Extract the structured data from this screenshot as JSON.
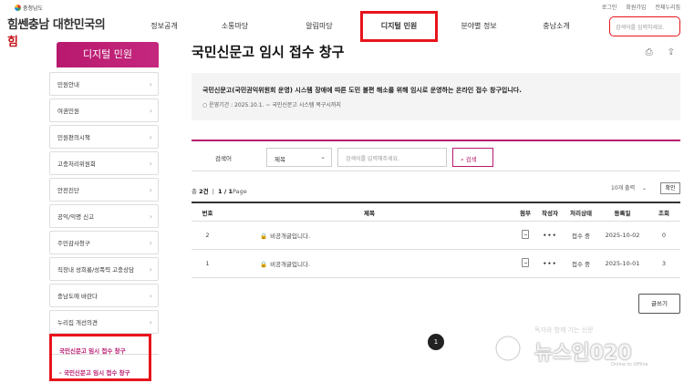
{
  "utility": [
    "로그인",
    "회원가입",
    "전체누리집"
  ],
  "logo": {
    "province": "충청남도",
    "slogan_a": "힘쎈충남",
    "slogan_b": "대한민국의",
    "slogan_c": "힘"
  },
  "gnb": [
    {
      "label": "정보공개"
    },
    {
      "label": "소통마당"
    },
    {
      "label": "알림마당"
    },
    {
      "label": "디지털 민원"
    },
    {
      "label": "분야별 정보"
    },
    {
      "label": "충남소개"
    }
  ],
  "top_search": {
    "placeholder": "검색어를 입력하세요."
  },
  "sidebar": {
    "title": "디지털 민원",
    "items": [
      {
        "label": "민원안내"
      },
      {
        "label": "여권민원"
      },
      {
        "label": "민원편의시책"
      },
      {
        "label": "고충처리위원회"
      },
      {
        "label": "안전진단"
      },
      {
        "label": "공익/익명 신고"
      },
      {
        "label": "주민감사청구"
      },
      {
        "label": "직장내 성희롱/성폭력 고충상담"
      },
      {
        "label": "충남도에 바란다"
      },
      {
        "label": "누리집 개선의견"
      }
    ],
    "active_group": "국민신문고 임시 접수 창구",
    "active_sub": "- 국민신문고 임시 접수 창구"
  },
  "page_title": "국민신문고 임시 접수 창구",
  "notice": {
    "text": "국민신문고(국민권익위원회 운영) 시스템 장애에 따른 도민 불편 해소를 위해 임시로 운영하는 온라인 접수 창구입니다.",
    "period": "○ 운영기간 : 2025.10.1. ~ 국민신문고 시스템 복구시까지"
  },
  "search": {
    "label": "검색어",
    "select_value": "제목",
    "placeholder": "검색어를 입력해주세요.",
    "button": "검색"
  },
  "count": {
    "prefix": "총",
    "total": "2건",
    "page": "1 / 1",
    "page_suffix": "Page"
  },
  "per_page": {
    "label": "10개 출력",
    "button": "확인"
  },
  "table": {
    "headers": [
      "번호",
      "제목",
      "첨부",
      "작성자",
      "처리상태",
      "등록일",
      "조회"
    ],
    "rows": [
      {
        "no": "2",
        "title": "비공개글입니다.",
        "author": "•••",
        "status": "접수 중",
        "date": "2025-10-02",
        "views": "0"
      },
      {
        "no": "1",
        "title": "비공개글입니다.",
        "author": "•••",
        "status": "접수 중",
        "date": "2025-10-01",
        "views": "3"
      }
    ]
  },
  "write_button": "글쓰기",
  "pager": {
    "current": "1"
  },
  "watermark": {
    "sub": "독자와 함께 가는 신문",
    "main": "뉴스인020",
    "eng": "Online to Offline"
  }
}
